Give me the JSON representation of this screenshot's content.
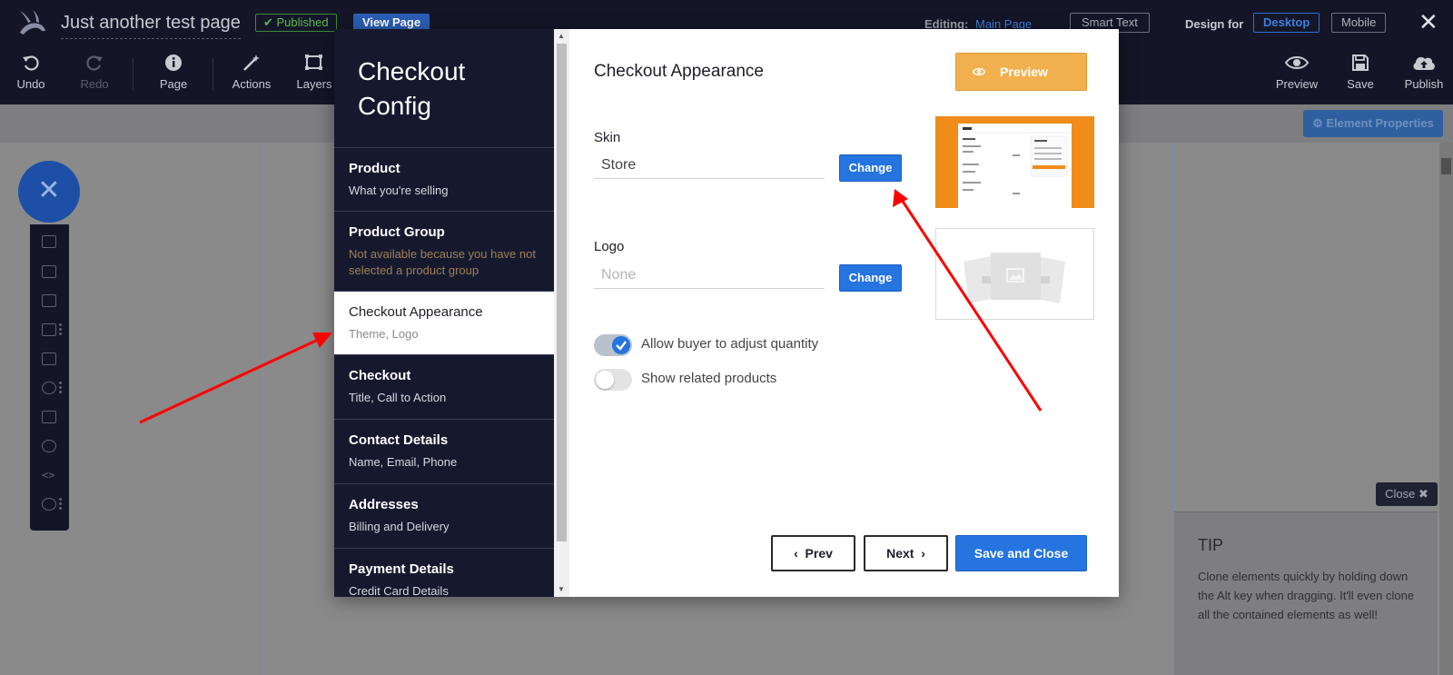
{
  "topbar": {
    "page_name": "Just another test page",
    "published_label": "✔ Published",
    "view_page_label": "View Page",
    "editing_label": "Editing:",
    "editing_link": "Main Page",
    "smart_text_label": "Smart Text",
    "design_for_label": "Design for",
    "desktop_label": "Desktop",
    "mobile_label": "Mobile",
    "close_glyph": "✕",
    "tools": {
      "undo": "Undo",
      "redo": "Redo",
      "page": "Page",
      "actions": "Actions",
      "layers": "Layers",
      "preview": "Preview",
      "save": "Save",
      "publish": "Publish"
    }
  },
  "canvas": {
    "element_properties_label": "⚙ Element Properties",
    "fab_glyph": "✕",
    "tip_close_label": "Close ✖",
    "tip_title": "TIP",
    "tip_text": "Clone elements quickly by holding down the Alt key when dragging. It'll even clone all the contained elements as well!"
  },
  "modal": {
    "sidebar_title": "Checkout Config",
    "nav": [
      {
        "title": "Product",
        "subtitle": "What you're selling",
        "active": false
      },
      {
        "title": "Product Group",
        "subtitle": "Not available because you have not selected a product group",
        "active": false
      },
      {
        "title": "Checkout Appearance",
        "subtitle": "Theme, Logo",
        "active": true
      },
      {
        "title": "Checkout",
        "subtitle": "Title, Call to Action",
        "active": false
      },
      {
        "title": "Contact Details",
        "subtitle": "Name, Email, Phone",
        "active": false
      },
      {
        "title": "Addresses",
        "subtitle": "Billing and Delivery",
        "active": false
      },
      {
        "title": "Payment Details",
        "subtitle": "Credit Card Details",
        "active": false
      }
    ],
    "content_title": "Checkout Appearance",
    "preview_label": "Preview",
    "skin_label": "Skin",
    "skin_value": "Store",
    "logo_label": "Logo",
    "logo_placeholder": "None",
    "change_label": "Change",
    "toggle_quantity": {
      "label": "Allow buyer to adjust quantity",
      "on": true
    },
    "toggle_related": {
      "label": "Show related products",
      "on": false
    },
    "prev_label": "Prev",
    "next_label": "Next",
    "save_close_label": "Save and Close"
  },
  "colors": {
    "topbar_bg": "#141628",
    "sidebar_bg": "#16192e",
    "primary_blue": "#2574e0",
    "preview_orange": "#f2b04e",
    "annotation_arrow": "#ff0000"
  }
}
